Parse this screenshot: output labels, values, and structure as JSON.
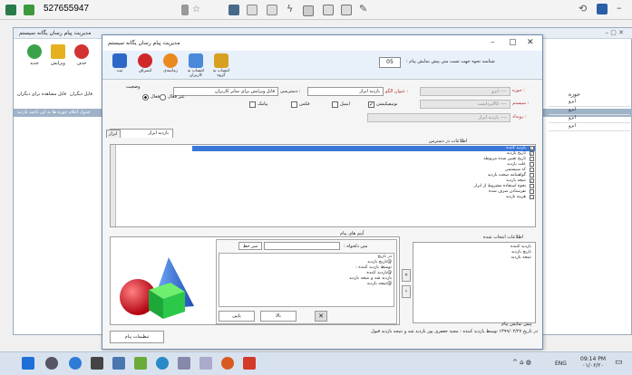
{
  "topbar": {
    "remote_id": "527655947"
  },
  "bgwin": {
    "title": "مدیریت پیام رسان یگانه سیستم",
    "toolbar": [
      "جدید",
      "ویرایش",
      "حذف"
    ],
    "bar_text": "جدول اعلام حوزه ها به این ناحیه بازدید",
    "cols": [
      "فایل مشاهده برای دیگران",
      "فایل دیگران",
      "حوزه"
    ],
    "rows": [
      "ابزو",
      "ابزو",
      "ابزو",
      "ابزو"
    ]
  },
  "dialog": {
    "title": "مدیریت پیام رسان یگانه سیستم",
    "toolbar": {
      "save": "ثبت",
      "cancel": "انصراف",
      "reminder": "زمانبندی",
      "assign_users": "انتساب به کاربران",
      "assign_groups": "انتساب به گروه"
    },
    "display_period_label": "شناسه نحوه جهت تست متن پیش نمایش پیام :",
    "display_period_value": "05",
    "area_label": "حوزه :",
    "area_value": "---- ابزو",
    "system_label": "سیستم :",
    "system_value": "---- کالابرداشت",
    "process_label": "رویداد :",
    "process_value": "---- بازدید ابزار",
    "title_label": "عنوان الگو :",
    "title_value": "بازدید ابزار",
    "access_label": "دسترسی :",
    "access_value": "قابل ویرایش برای سایر کاربران",
    "status_label": "وضعیت",
    "active_label": "فعال",
    "inactive_label": "غیر فعال",
    "channels": {
      "notification": "نوتیفیکیشن",
      "email": "ایمیل",
      "fax": "فکس",
      "sms": "پیامک"
    },
    "tabs": [
      "بازدید ابزار",
      "ابزار"
    ],
    "access_info_header": "اطلاعات در دسترس",
    "access_info_items": [
      {
        "label": "بازدید کننده",
        "checked": true
      },
      {
        "label": "تاریخ بازدید",
        "checked": true
      },
      {
        "label": "تاریخ تعیین شده مربوطه",
        "checked": false
      },
      {
        "label": "علت بازدید",
        "checked": false
      },
      {
        "label": "کد سیستمی",
        "checked": false
      },
      {
        "label": "گواهینامه صحت بازدید",
        "checked": false
      },
      {
        "label": "نتیجه بازدید",
        "checked": true
      },
      {
        "label": "نحوه استفاده مشروط از ابزار",
        "checked": false
      },
      {
        "label": "تفرستادن صرف شده",
        "checked": false
      },
      {
        "label": "هزینه بازدید",
        "checked": false
      }
    ],
    "message_items_header": "آیتم های پیام",
    "desired_text_label": "متن دلخواه :",
    "line_break_button": "سر خط",
    "message_lines": [
      "در تاریخ",
      "@تاریخ بازدید",
      "توسط  بازدید کننده :",
      "@بازدید کننده",
      "بازدید شد و نتیجه بازدید",
      "@نتیجه بازدید"
    ],
    "up_button": "بالا",
    "down_button": "پایین",
    "selected_info_header": "اطلاعات انتخاب شده",
    "selected_items": [
      "بازدید کننده",
      "تاریخ بازدید",
      "نتیجه بازدید"
    ],
    "preview_header": "پیش نمایش پیام",
    "preview_text": "در تاریخ ۱۳۹۹/۰۲/۲۷ توسط بازدید کننده : مجید جعفری پور بازدید شد و نتیجه بازدید قبول",
    "settings_button": "تنظیمات پیام"
  },
  "taskbar": {
    "lang": "ENG",
    "time": "09:14 PM",
    "date": "۰۱/۰۶/۲۰"
  },
  "colors": {
    "accent": "#2f6fd8",
    "selection": "#3a78d8",
    "title_red": "#a33"
  }
}
